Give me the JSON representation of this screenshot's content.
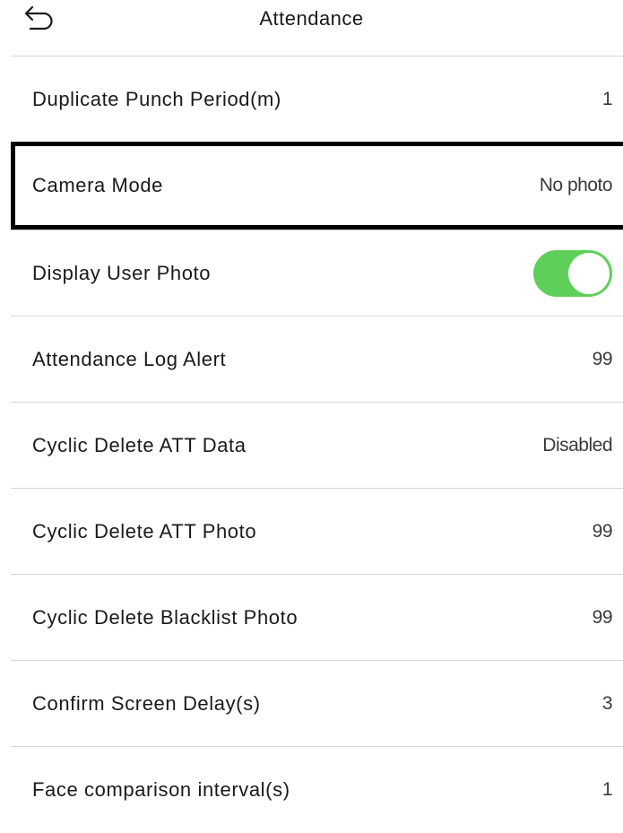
{
  "header": {
    "title": "Attendance",
    "back_icon": "back-arrow-icon"
  },
  "settings": [
    {
      "label": "Duplicate Punch Period(m)",
      "value": "1"
    },
    {
      "label": "Camera Mode",
      "value": "No photo"
    },
    {
      "label": "Display User Photo",
      "toggle_on": true
    },
    {
      "label": "Attendance Log Alert",
      "value": "99"
    },
    {
      "label": "Cyclic Delete ATT Data",
      "value": "Disabled"
    },
    {
      "label": "Cyclic Delete ATT Photo",
      "value": "99"
    },
    {
      "label": "Cyclic Delete Blacklist Photo",
      "value": "99"
    },
    {
      "label": "Confirm Screen Delay(s)",
      "value": "3"
    },
    {
      "label": "Face comparison interval(s)",
      "value": "1"
    }
  ],
  "colors": {
    "toggle_on": "#5ed05a",
    "highlight_border": "#000000",
    "divider": "#d6d6d6"
  }
}
